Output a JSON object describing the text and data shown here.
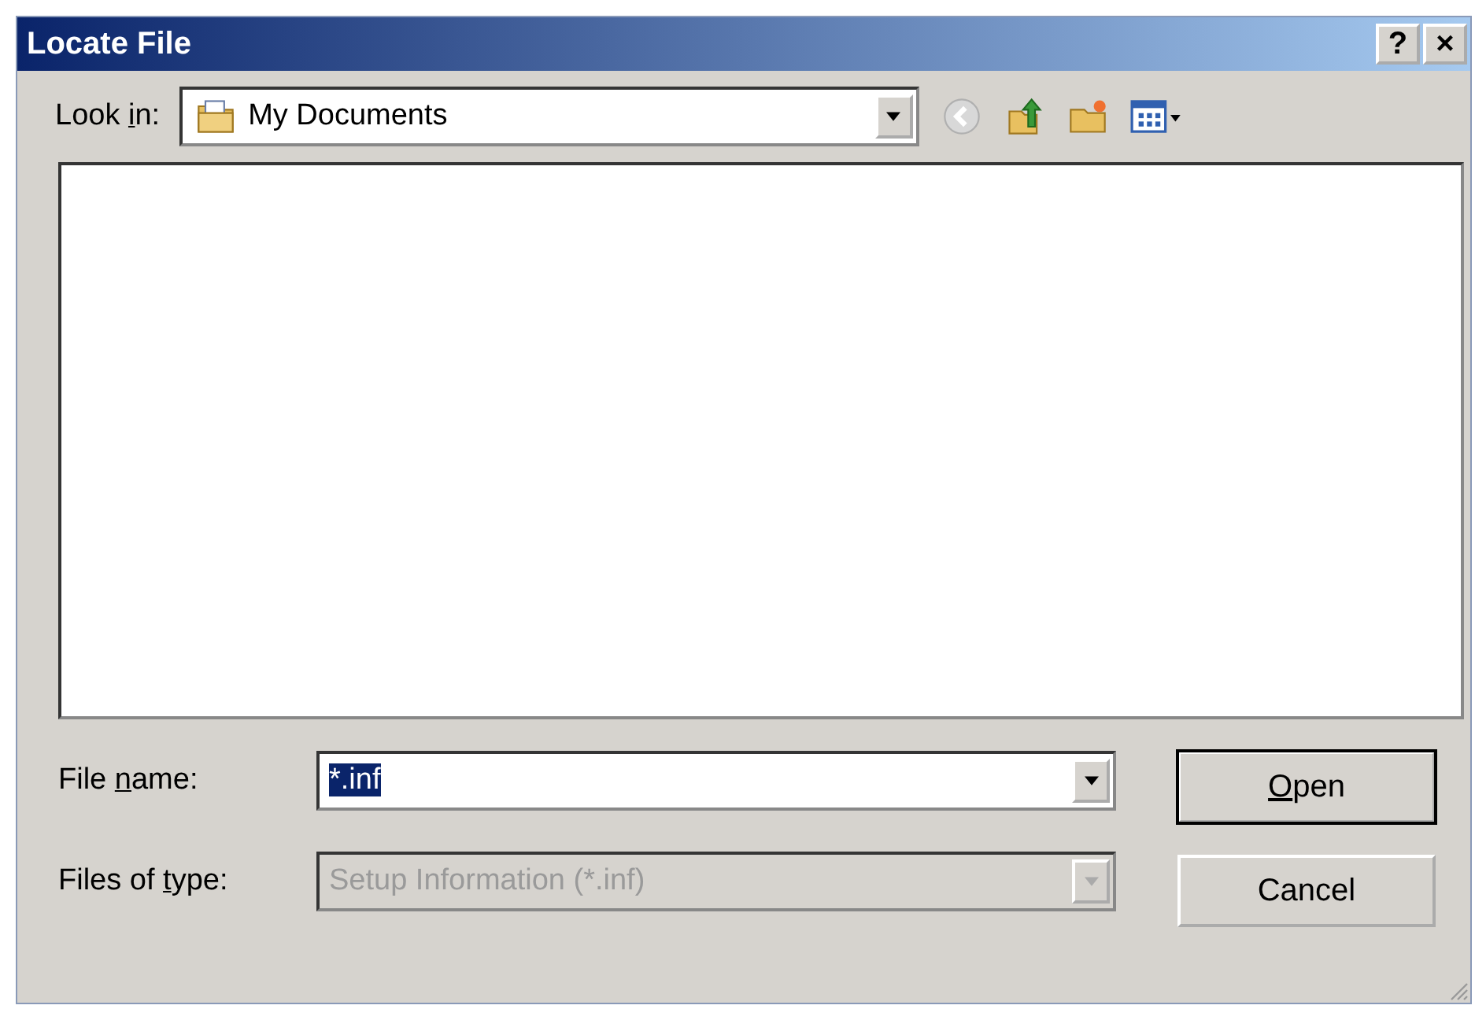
{
  "window": {
    "title": "Locate File",
    "buttons": [
      {
        "label": "?"
      },
      {
        "label": "×"
      }
    ]
  },
  "look_in": {
    "label": {
      "before": "Look ",
      "key": "i",
      "after": "n:"
    },
    "value": "My Documents"
  },
  "file_name": {
    "label": {
      "before": "File ",
      "key": "n",
      "after": "ame:"
    },
    "value": "*.inf",
    "selected": true
  },
  "files_of_type": {
    "label": {
      "before": "Files of ",
      "key": "t",
      "after": "ype:"
    },
    "value": "Setup Information (*.inf)",
    "disabled": true
  },
  "buttons": [
    {
      "label": {
        "key": "O",
        "after": "pen"
      },
      "default": true
    },
    {
      "label": {
        "before": "Cancel"
      },
      "default": false
    }
  ]
}
